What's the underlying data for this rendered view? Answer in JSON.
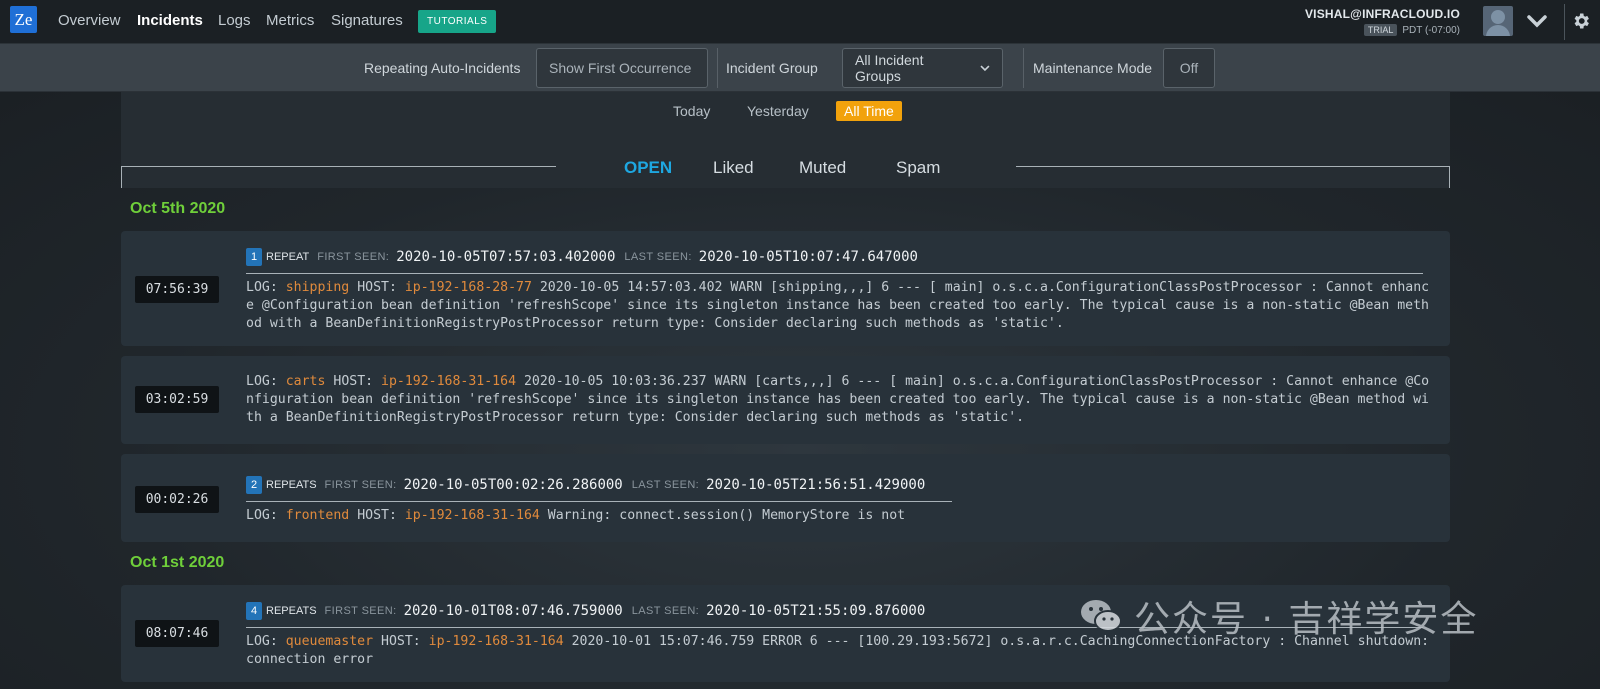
{
  "nav": {
    "logo": "Ze",
    "links": [
      "Overview",
      "Incidents",
      "Logs",
      "Metrics",
      "Signatures"
    ],
    "active": "Incidents",
    "tutorials": "TUTORIALS",
    "user_email": "VISHAL@INFRACLOUD.IO",
    "trial_badge": "TRIAL",
    "timezone": "PDT (-07:00)"
  },
  "filters": {
    "repeating_label": "Repeating Auto-Incidents",
    "repeating_value": "Show First Occurrence",
    "group_label": "Incident Group",
    "group_value": "All Incident Groups",
    "maintenance_label": "Maintenance Mode",
    "maintenance_value": "Off"
  },
  "time_tabs": [
    "Today",
    "Yesterday",
    "All Time"
  ],
  "time_tab_active": "All Time",
  "status_tabs": [
    "OPEN",
    "Liked",
    "Muted",
    "Spam"
  ],
  "status_tab_active": "OPEN",
  "groups": [
    {
      "date": "Oct 5th 2020",
      "incidents": [
        {
          "time": "07:56:39",
          "count": "1",
          "repeat_word": "REPEAT",
          "first_seen_label": "FIRST SEEN:",
          "first_seen": "2020-10-05T07:57:03.402000",
          "last_seen_label": "LAST SEEN:",
          "last_seen": "2020-10-05T10:07:47.647000",
          "log_prefix": "LOG:",
          "service": "shipping",
          "host_label": "HOST:",
          "host": "ip-192-168-28-77",
          "message": "2020-10-05 14:57:03.402 WARN [shipping,,,] 6 --- [ main] o.s.c.a.ConfigurationClassPostProcessor : Cannot enhance @Configuration bean definition 'refreshScope' since its singleton instance has been created too early. The typical cause is a non-static @Bean method with a BeanDefinitionRegistryPostProcessor return type: Consider declaring such methods as 'static'."
        },
        {
          "time": "03:02:59",
          "log_prefix": "LOG:",
          "service": "carts",
          "host_label": "HOST:",
          "host": "ip-192-168-31-164",
          "message": "2020-10-05 10:03:36.237 WARN [carts,,,] 6 --- [ main] o.s.c.a.ConfigurationClassPostProcessor : Cannot enhance @Configuration bean definition 'refreshScope' since its singleton instance has been created too early. The typical cause is a non-static @Bean method with a BeanDefinitionRegistryPostProcessor return type: Consider declaring such methods as 'static'."
        },
        {
          "time": "00:02:26",
          "count": "2",
          "repeat_word": "REPEATS",
          "first_seen_label": "FIRST SEEN:",
          "first_seen": "2020-10-05T00:02:26.286000",
          "last_seen_label": "LAST SEEN:",
          "last_seen": "2020-10-05T21:56:51.429000",
          "log_prefix": "LOG:",
          "service": "frontend",
          "host_label": "HOST:",
          "host": "ip-192-168-31-164",
          "message": "Warning: connect.session() MemoryStore is not"
        }
      ]
    },
    {
      "date": "Oct 1st 2020",
      "incidents": [
        {
          "time": "08:07:46",
          "count": "4",
          "repeat_word": "REPEATS",
          "first_seen_label": "FIRST SEEN:",
          "first_seen": "2020-10-01T08:07:46.759000",
          "last_seen_label": "LAST SEEN:",
          "last_seen": "2020-10-05T21:55:09.876000",
          "log_prefix": "LOG:",
          "service": "queuemaster",
          "host_label": "HOST:",
          "host": "ip-192-168-31-164",
          "message": "2020-10-01 15:07:46.759 ERROR 6 --- [100.29.193:5672] o.s.a.r.c.CachingConnectionFactory : Channel shutdown: connection error"
        }
      ]
    }
  ],
  "watermark": "公众号 · 吉祥学安全"
}
